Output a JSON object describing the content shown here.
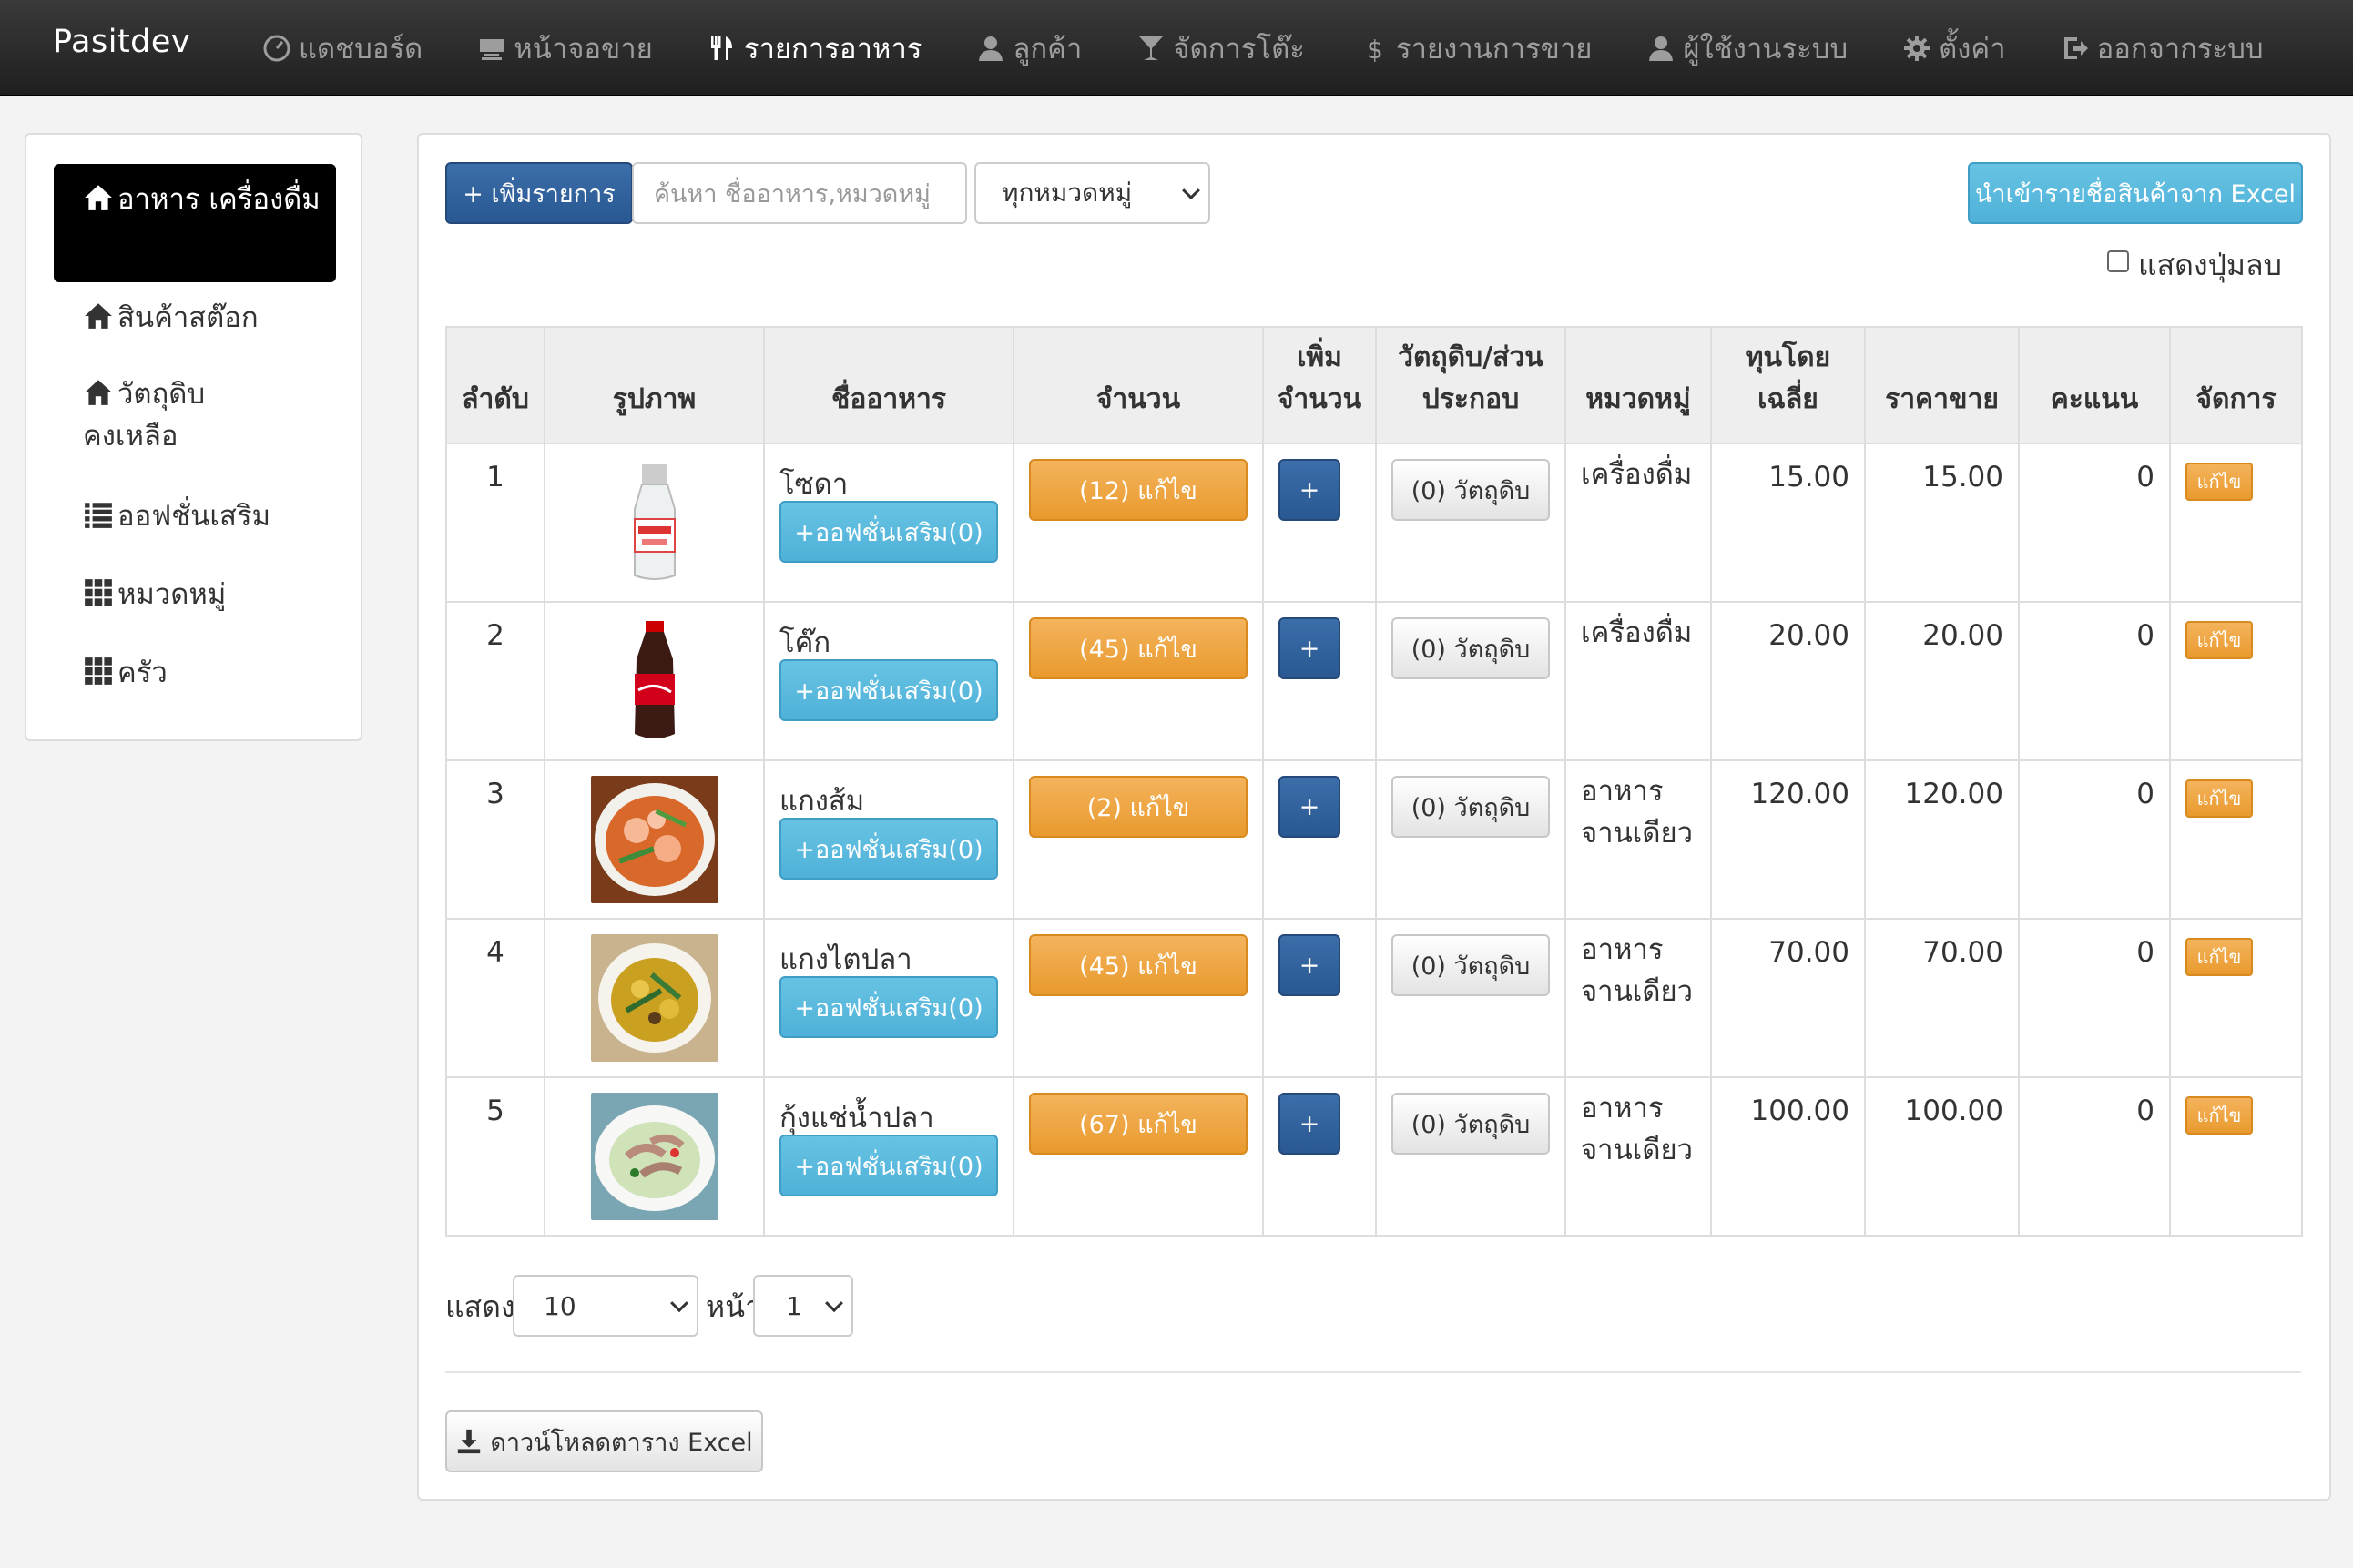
{
  "app": {
    "brand": "Pasitdev"
  },
  "nav": [
    {
      "label": "แดชบอร์ด",
      "icon": "dashboard-icon"
    },
    {
      "label": "หน้าจอขาย",
      "icon": "pos-icon"
    },
    {
      "label": "รายการอาหาร",
      "icon": "cutlery-icon",
      "active": true
    },
    {
      "label": "ลูกค้า",
      "icon": "user-icon"
    },
    {
      "label": "จัดการโต๊ะ",
      "icon": "glass-icon"
    },
    {
      "label": "รายงานการขาย",
      "icon": "dollar-icon"
    },
    {
      "label": "ผู้ใช้งานระบบ",
      "icon": "user-icon"
    },
    {
      "label": "ตั้งค่า",
      "icon": "gear-icon"
    },
    {
      "label": "ออกจากระบบ",
      "icon": "logout-icon"
    }
  ],
  "sidebar": {
    "items": [
      {
        "label": "อาหาร เครื่องดื่ม",
        "icon": "home-icon",
        "active": true
      },
      {
        "label": "สินค้าสต๊อก",
        "icon": "home-icon"
      },
      {
        "label": "วัตถุดิบ คงเหลือ",
        "icon": "home-icon"
      },
      {
        "label": "ออฟชั่นเสริม",
        "icon": "list-icon"
      },
      {
        "label": "หมวดหมู่",
        "icon": "grid-icon"
      },
      {
        "label": "ครัว",
        "icon": "grid-icon"
      }
    ]
  },
  "toolbar": {
    "add_label": "+ เพิ่มรายการ",
    "search_placeholder": "ค้นหา ชื่ออาหาร,หมวดหมู่",
    "category_filter": "ทุกหมวดหมู่",
    "import_label": "นำเข้ารายชื่อสินค้าจาก Excel",
    "show_delete_label": "แสดงปุ่มลบ"
  },
  "table": {
    "headers": [
      "ลำดับ",
      "รูปภาพ",
      "ชื่ออาหาร",
      "จำนวน",
      "เพิ่ม จำนวน",
      "วัตถุดิบ/ส่วน ประกอบ",
      "หมวดหมู่",
      "ทุนโดย เฉลี่ย",
      "ราคาขาย",
      "คะแนน",
      "จัดการ"
    ],
    "rows": [
      {
        "no": "1",
        "image": "soda-bottle",
        "name": "โซดา",
        "option_label": "+ออฟชั่นเสริม(0)",
        "qty_label": "(12) แก้ไข",
        "add_label": "+",
        "ingredient_label": "(0) วัตถุดิบ",
        "category": "เครื่องดื่ม",
        "cost": "15.00",
        "price": "15.00",
        "points": "0",
        "edit_label": "แก้ไข"
      },
      {
        "no": "2",
        "image": "coke-bottle",
        "name": "โค๊ก",
        "option_label": "+ออฟชั่นเสริม(0)",
        "qty_label": "(45) แก้ไข",
        "add_label": "+",
        "ingredient_label": "(0) วัตถุดิบ",
        "category": "เครื่องดื่ม",
        "cost": "20.00",
        "price": "20.00",
        "points": "0",
        "edit_label": "แก้ไข"
      },
      {
        "no": "3",
        "image": "sour-curry",
        "name": "แกงส้ม",
        "option_label": "+ออฟชั่นเสริม(0)",
        "qty_label": "(2) แก้ไข",
        "add_label": "+",
        "ingredient_label": "(0) วัตถุดิบ",
        "category": "อาหาร จานเดียว",
        "cost": "120.00",
        "price": "120.00",
        "points": "0",
        "edit_label": "แก้ไข"
      },
      {
        "no": "4",
        "image": "fish-curry",
        "name": "แกงไตปลา",
        "option_label": "+ออฟชั่นเสริม(0)",
        "qty_label": "(45) แก้ไข",
        "add_label": "+",
        "ingredient_label": "(0) วัตถุดิบ",
        "category": "อาหาร จานเดียว",
        "cost": "70.00",
        "price": "70.00",
        "points": "0",
        "edit_label": "แก้ไข"
      },
      {
        "no": "5",
        "image": "shrimp-dish",
        "name": "กุ้งแช่น้ำปลา",
        "option_label": "+ออฟชั่นเสริม(0)",
        "qty_label": "(67) แก้ไข",
        "add_label": "+",
        "ingredient_label": "(0) วัตถุดิบ",
        "category": "อาหาร จานเดียว",
        "cost": "100.00",
        "price": "100.00",
        "points": "0",
        "edit_label": "แก้ไข"
      }
    ]
  },
  "pagination": {
    "show_label": "แสดง",
    "page_size": "10",
    "page_label": "หน้า",
    "page": "1"
  },
  "footer": {
    "download_label": "ดาวน์โหลดตาราง Excel"
  }
}
